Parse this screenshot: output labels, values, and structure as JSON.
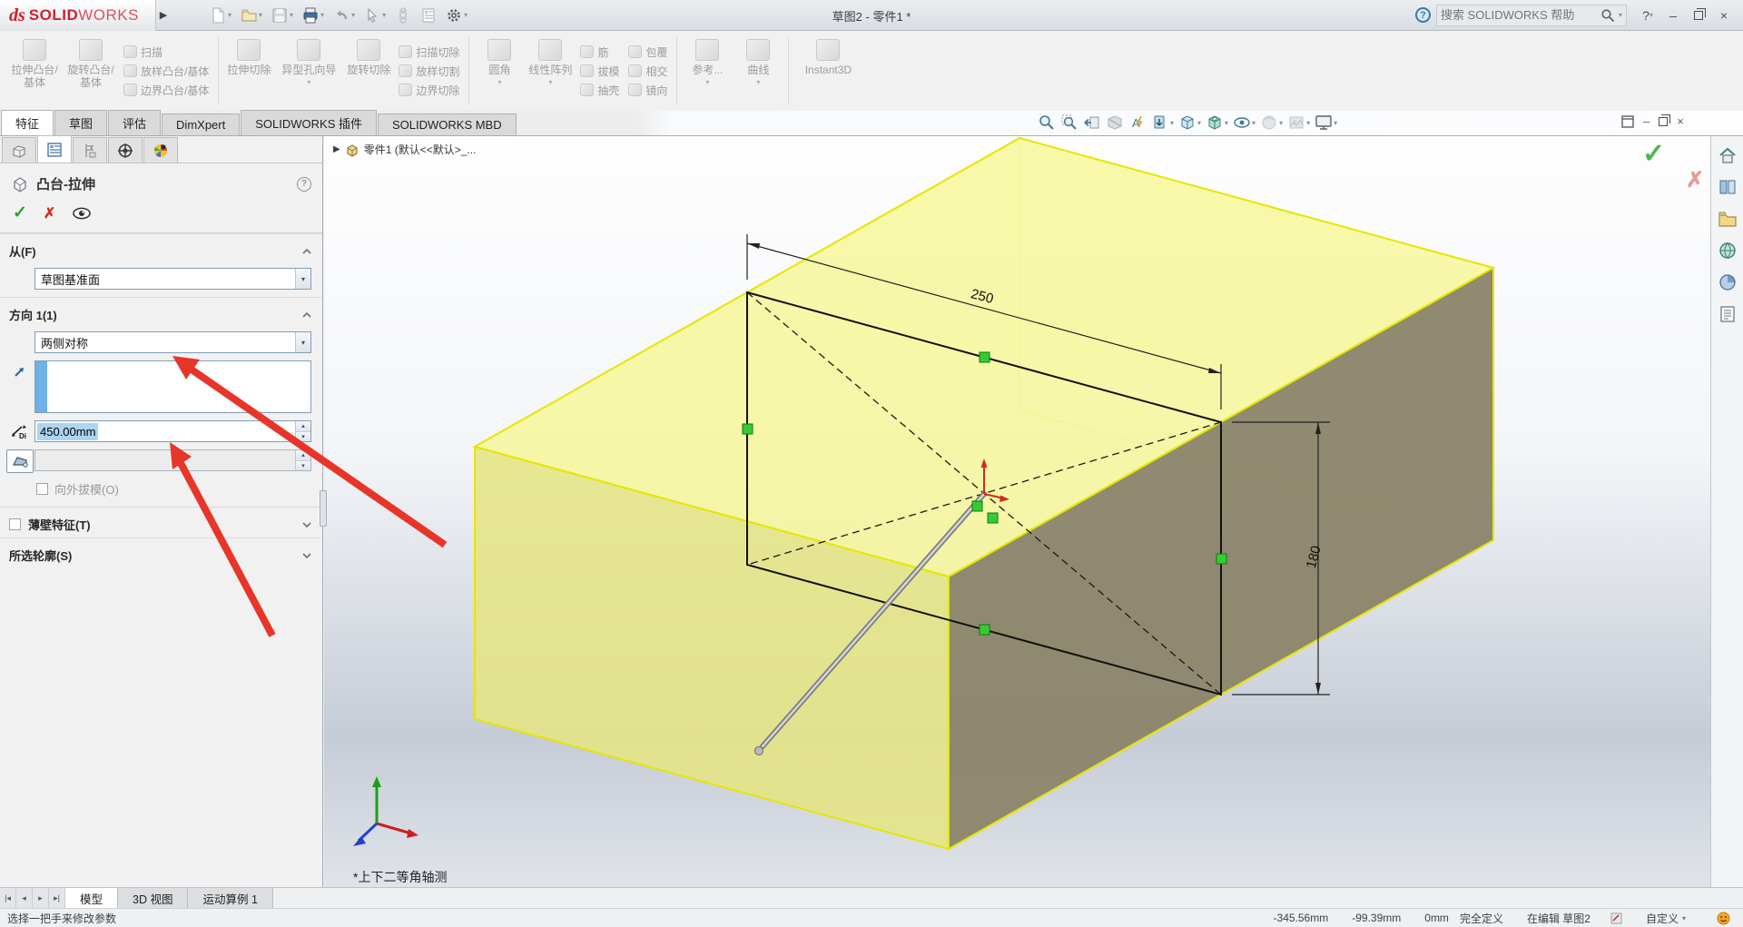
{
  "window": {
    "logo_ds": "ds",
    "logo_solid": "SOLID",
    "logo_works": "WORKS",
    "title": "草图2 - 零件1 *",
    "search_placeholder": "搜索 SOLIDWORKS 帮助"
  },
  "icons": {
    "caret": "▾",
    "up": "▴",
    "down": "▾",
    "check": "✓",
    "cross": "✗",
    "help_q": "?",
    "close": "×",
    "minimize": "–",
    "flyout_right": "▶",
    "nav_first": "|◂",
    "nav_prev": "◂",
    "nav_next": "▸",
    "nav_last": "▸|"
  },
  "ribbon": {
    "groups": [
      {
        "big": [
          {
            "label": "拉伸凸台/基体"
          },
          {
            "label": "旋转凸台/基体"
          }
        ],
        "small": [
          "扫描",
          "放样凸台/基体",
          "边界凸台/基体"
        ]
      },
      {
        "big": [
          {
            "label": "拉伸切除"
          },
          {
            "label": "异型孔向导"
          },
          {
            "label": "旋转切除"
          }
        ],
        "small": [
          "扫描切除",
          "放样切割",
          "边界切除"
        ]
      },
      {
        "big": [
          {
            "label": "圆角"
          },
          {
            "label": "线性阵列"
          }
        ],
        "small": [
          "筋",
          "拔模",
          "抽壳",
          "包覆",
          "相交",
          "镜向"
        ]
      },
      {
        "big": [
          {
            "label": "参考..."
          },
          {
            "label": "曲线"
          }
        ],
        "small": []
      },
      {
        "big": [
          {
            "label": "Instant3D"
          }
        ],
        "small": []
      }
    ]
  },
  "command_tabs": {
    "items": [
      "特征",
      "草图",
      "评估",
      "DimXpert",
      "SOLIDWORKS 插件",
      "SOLIDWORKS MBD"
    ]
  },
  "pm": {
    "title": "凸台-拉伸",
    "from_label": "从(F)",
    "from_value": "草图基准面",
    "dir_label": "方向 1(1)",
    "dir_value": "两侧对称",
    "depth_value": "450.00mm",
    "draft_value": "",
    "outward_draft_label": "向外拔模(O)",
    "thin_label": "薄壁特征(T)",
    "contours_label": "所选轮廓(S)"
  },
  "viewport": {
    "feature_tree": "零件1 (默认<<默认>_...",
    "view_label": "*上下二等角轴测",
    "dim_width": "250",
    "dim_height": "180"
  },
  "bottom_tabs": {
    "model": "模型",
    "view3d": "3D 视图",
    "motion": "运动算例 1"
  },
  "status": {
    "hint": "选择一把手来修改参数",
    "x": "-345.56mm",
    "y": "-99.39mm",
    "z": "0mm",
    "state": "完全定义",
    "editing": "在编辑 草图2",
    "units": "自定义"
  },
  "colors": {
    "brand_red": "#d11f2b",
    "preview_yellow": "#f0f095",
    "face_dark": "#8e8970",
    "handle_green": "#33cc33",
    "selection_blue": "#add4f2",
    "annotation_red": "#e8352a"
  }
}
